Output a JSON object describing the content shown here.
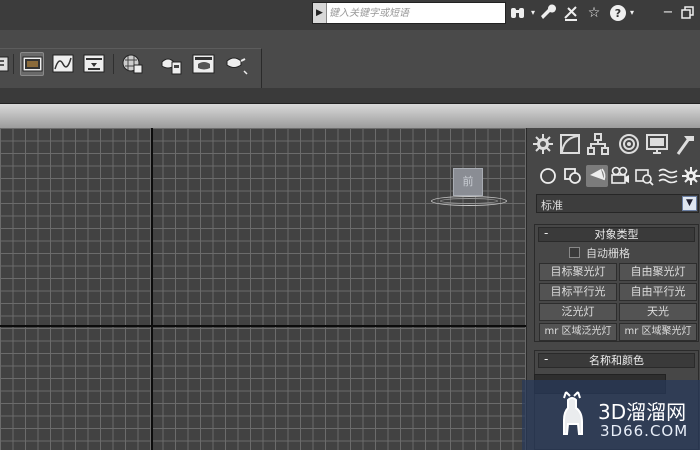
{
  "search": {
    "placeholder": "键入关键字或短语"
  },
  "command_panel": {
    "dropdown_value": "标准",
    "object_type": {
      "title": "对象类型",
      "autogrid_label": "自动栅格",
      "buttons": [
        "目标聚光灯",
        "自由聚光灯",
        "目标平行光",
        "自由平行光",
        "泛光灯",
        "天光",
        "mr 区域泛光灯",
        "mr 区域聚光灯"
      ]
    },
    "name_color": {
      "title": "名称和颜色"
    }
  },
  "viewport": {
    "light_label": "前"
  },
  "watermark": {
    "title": "3D溜溜网",
    "subtitle": "3D66.COM"
  },
  "colors": {
    "viewport_bg": "#424242",
    "grid_line": "#6b6b6b",
    "axis": "#0c0c0c",
    "panel_bg": "#474747",
    "watermark_bg": "#283a5c"
  }
}
